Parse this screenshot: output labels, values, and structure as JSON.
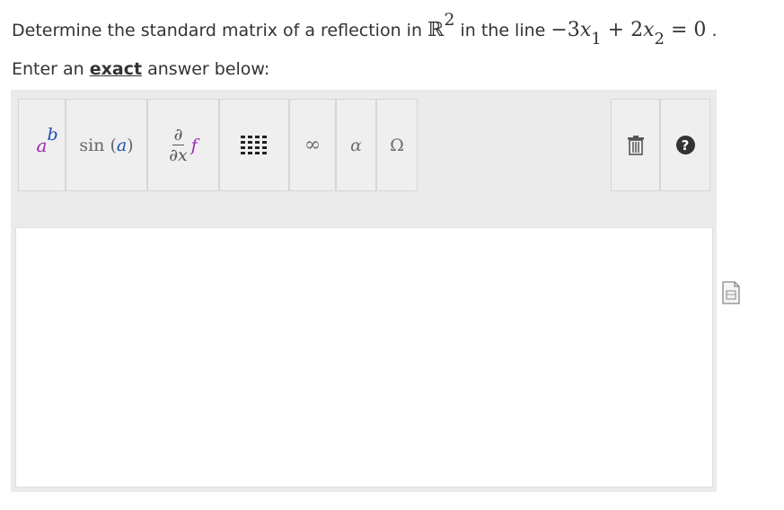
{
  "question": {
    "prefix": "Determine the standard matrix of a reflection in ",
    "space": "ℝ",
    "space_exp": "2",
    "middle": " in the line ",
    "eq_part1": "−3",
    "var1": "x",
    "sub1": "1",
    "eq_part2": " + 2",
    "var2": "x",
    "sub2": "2",
    "eq_part3": " = 0",
    "suffix": " ."
  },
  "instruction": {
    "before": "Enter an ",
    "emphasis": "exact",
    "after": " answer below:"
  },
  "toolbar": {
    "power": {
      "base": "a",
      "exp": "b"
    },
    "sin": {
      "fn": "sin",
      "open": " (",
      "arg": "a",
      "close": ")"
    },
    "derivative": {
      "num": "∂",
      "den": "∂x",
      "func": "f"
    },
    "infinity": "∞",
    "alpha": "α",
    "omega": "Ω",
    "help": "?"
  },
  "colors": {
    "purple": "#9c27b0",
    "blue": "#1a4fb5",
    "toolbar_bg": "#ebebeb"
  },
  "answer": {
    "value": ""
  }
}
